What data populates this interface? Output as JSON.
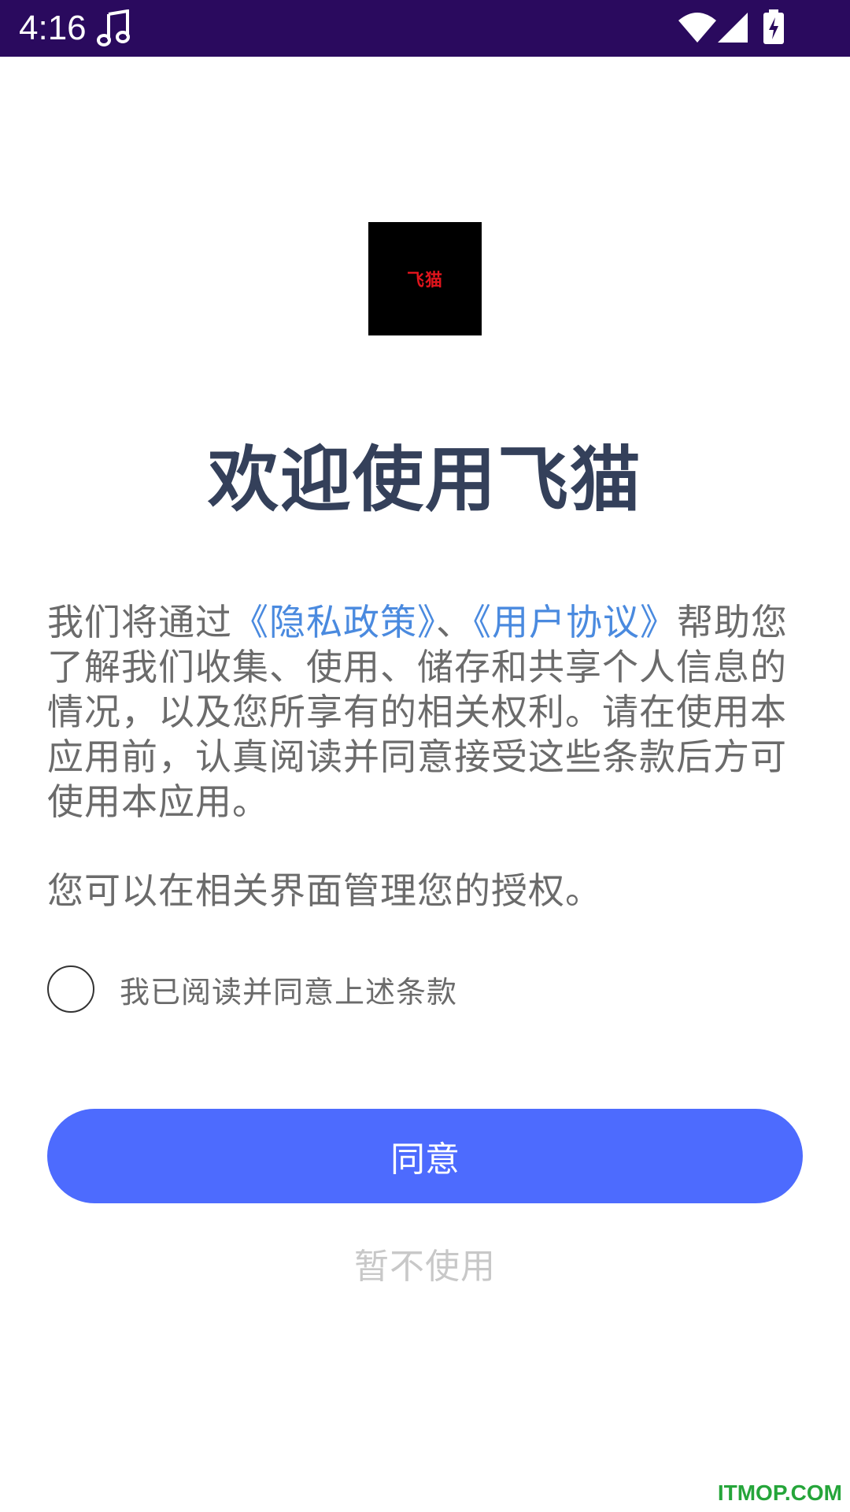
{
  "status_bar": {
    "time": "4:16",
    "background_color": "#2a0a5e",
    "icons": [
      "music-note-icon",
      "wifi-icon",
      "signal-icon",
      "battery-charging-icon"
    ]
  },
  "logo": {
    "text": "飞猫",
    "background_color": "#000000",
    "text_color": "#e0141c"
  },
  "welcome": {
    "title": "欢迎使用飞猫"
  },
  "intro": {
    "prefix": "我们将通过",
    "privacy_link": "《隐私政策》",
    "separator": "、",
    "terms_link": "《用户协议》",
    "suffix": "帮助您了解我们收集、使用、储存和共享个人信息的情况，以及您所享有的相关权利。请在使用本应用前，认真阅读并同意接受这些条款后方可使用本应用。"
  },
  "manage_text": "您可以在相关界面管理您的授权。",
  "consent": {
    "label": "我已阅读并同意上述条款",
    "checked": false
  },
  "buttons": {
    "agree": "同意",
    "decline": "暂不使用"
  },
  "colors": {
    "title": "#34405a",
    "body_text": "#6b6b6b",
    "link": "#4a8adf",
    "primary_button": "#4d6bfe",
    "decline_text": "#c8c8c8"
  },
  "watermark": "ITMOP.COM"
}
